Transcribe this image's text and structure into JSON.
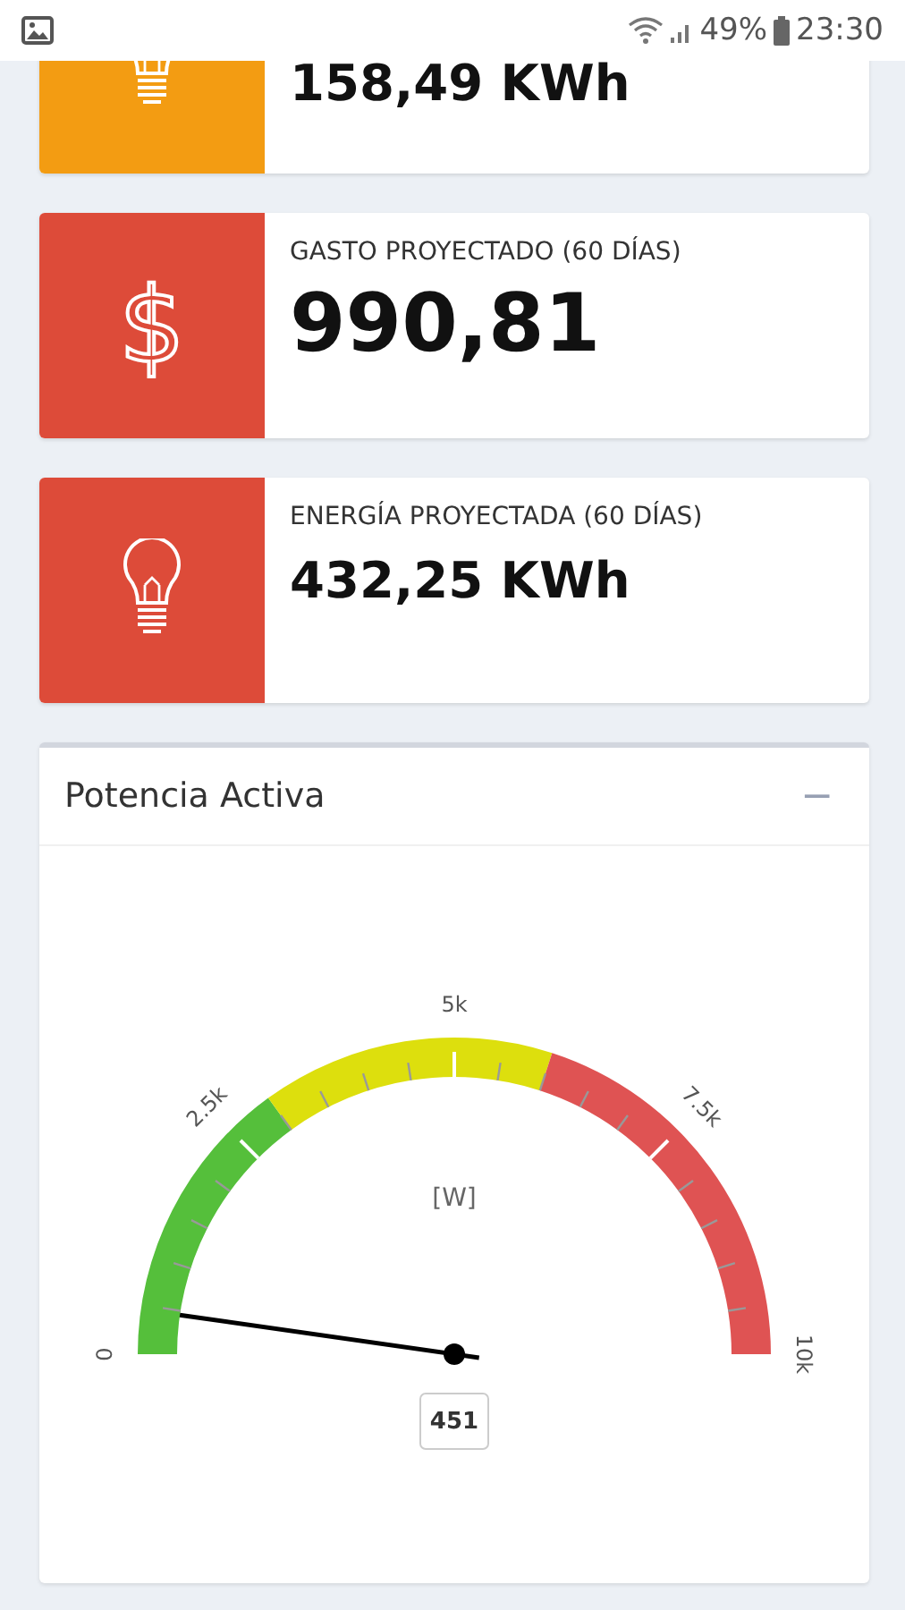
{
  "status_bar": {
    "battery_text": "49%",
    "time": "23:30"
  },
  "stat_cards": [
    {
      "kind": "energy",
      "color": "#f39c12",
      "value": "158,49 KWh",
      "emphasized": false
    },
    {
      "kind": "money",
      "icon_text": "$",
      "color": "#dd4b39",
      "label": "GASTO PROYECTADO (60 DÍAS)",
      "value": "990,81",
      "emphasized": true
    },
    {
      "kind": "energy",
      "color": "#dd4b39",
      "label": "ENERGÍA PROYECTADA (60 DÍAS)",
      "value": "432,25 KWh",
      "emphasized": false
    }
  ],
  "panel": {
    "title": "Potencia Activa",
    "collapse_button": "−",
    "gauge": {
      "unit": "[W]",
      "reading": "451",
      "level": 0.0451,
      "tick_labels": [
        "0",
        "2.5k",
        "5k",
        "7.5k",
        "10k"
      ],
      "bands": [
        {
          "color": "#55bf3b"
        },
        {
          "color": "#dddf0d"
        },
        {
          "color": "#df5353"
        }
      ]
    }
  }
}
